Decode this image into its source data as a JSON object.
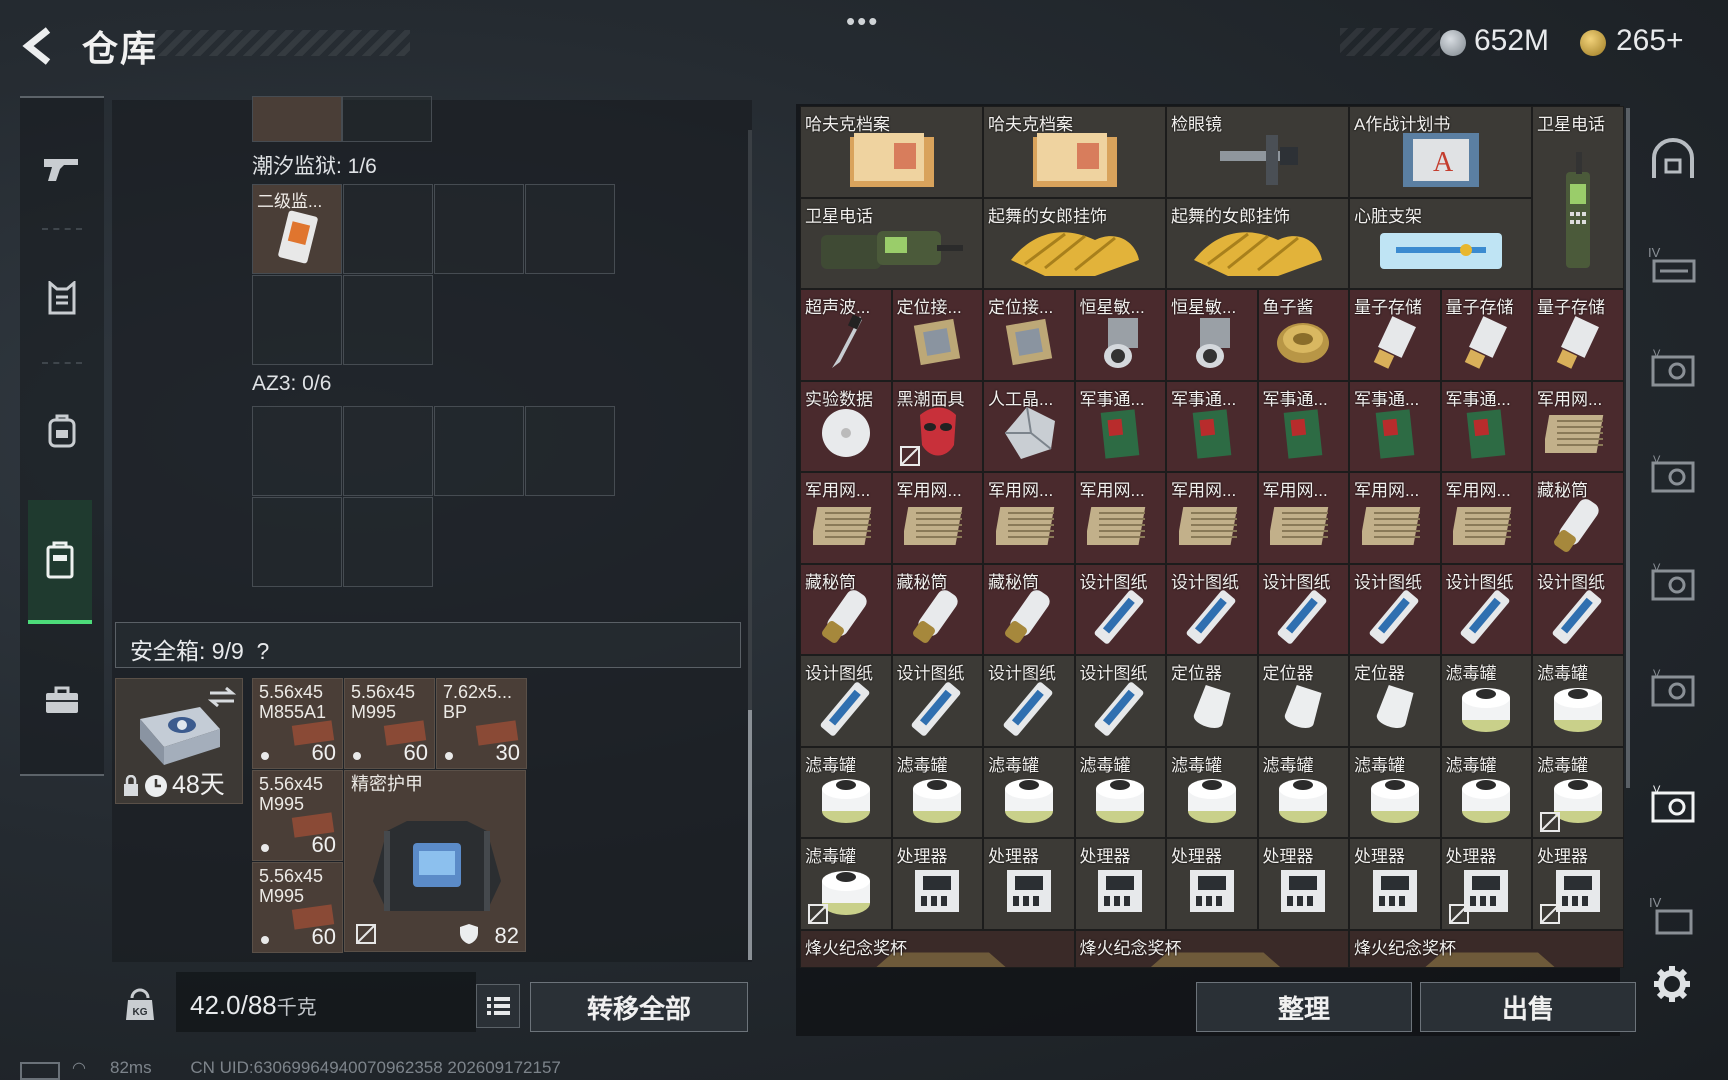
{
  "header": {
    "title": "仓库",
    "currency1": "652M",
    "currency2": "265+"
  },
  "left_tabs": [
    "gun-icon",
    "armor-icon",
    "backpack-icon",
    "locker-icon",
    "case-icon"
  ],
  "middle": {
    "section1": "潮汐监狱: 1/6",
    "section1_item": "二级监...",
    "section2": "AZ3: 0/6",
    "safe_box": "安全箱: 9/9",
    "safe_help": "?",
    "case_time": "48天",
    "slots": [
      {
        "name": "5.56x45\nM855A1",
        "count": "60"
      },
      {
        "name": "5.56x45\nM995",
        "count": "60"
      },
      {
        "name": "7.62x5...\nBP",
        "count": "30"
      },
      {
        "name": "5.56x45\nM995",
        "count": "60"
      },
      {
        "name": "5.56x45\nM995",
        "count": "60"
      }
    ],
    "armor": {
      "name": "精密护甲",
      "durability": "82"
    },
    "weight_value": "42.0/88",
    "weight_unit": "千克",
    "transfer_all": "转移全部"
  },
  "stash_items": [
    {
      "name": "哈夫克档案",
      "span": 2,
      "bg": "#3c3a36",
      "icon": "folder"
    },
    {
      "name": "哈夫克档案",
      "span": 2,
      "bg": "#3c3a36",
      "icon": "folder"
    },
    {
      "name": "检眼镜",
      "span": 2,
      "bg": "#3c3a36",
      "icon": "scope"
    },
    {
      "name": "A作战计划书",
      "span": 2,
      "bg": "#3c3a36",
      "icon": "plan"
    },
    {
      "name": "卫星电话",
      "span": 1,
      "tall": true,
      "bg": "#3c3a36",
      "icon": "phone"
    },
    {
      "name": "卫星电话",
      "span": 2,
      "bg": "#3c3a36",
      "icon": "phone2"
    },
    {
      "name": "起舞的女郎挂饰",
      "span": 2,
      "bg": "#3c3a36",
      "icon": "gold"
    },
    {
      "name": "起舞的女郎挂饰",
      "span": 2,
      "bg": "#3c3a36",
      "icon": "gold"
    },
    {
      "name": "心脏支架",
      "span": 2,
      "bg": "#3c3a36",
      "icon": "stent"
    },
    {
      "name": "超声波...",
      "bg": "#4a2a2d",
      "icon": "pen"
    },
    {
      "name": "定位接...",
      "bg": "#4a2a2d",
      "icon": "chip"
    },
    {
      "name": "定位接...",
      "bg": "#4a2a2d",
      "icon": "chip"
    },
    {
      "name": "恒星敏...",
      "bg": "#4a2a2d",
      "icon": "lens"
    },
    {
      "name": "恒星敏...",
      "bg": "#4a2a2d",
      "icon": "lens"
    },
    {
      "name": "鱼子酱",
      "bg": "#4a2a2d",
      "icon": "caviar"
    },
    {
      "name": "量子存储",
      "bg": "#4a2a2d",
      "icon": "usb"
    },
    {
      "name": "量子存储",
      "bg": "#4a2a2d",
      "icon": "usb"
    },
    {
      "name": "量子存储",
      "bg": "#4a2a2d",
      "icon": "usb"
    },
    {
      "name": "实验数据",
      "bg": "#4a2a2d",
      "icon": "disc"
    },
    {
      "name": "黑潮面具",
      "bg": "#4a2a2d",
      "icon": "mask",
      "nolock": true
    },
    {
      "name": "人工晶...",
      "bg": "#4a2a2d",
      "icon": "crystal"
    },
    {
      "name": "军事通...",
      "bg": "#4a2a2d",
      "icon": "book"
    },
    {
      "name": "军事通...",
      "bg": "#4a2a2d",
      "icon": "book"
    },
    {
      "name": "军事通...",
      "bg": "#4a2a2d",
      "icon": "book"
    },
    {
      "name": "军事通...",
      "bg": "#4a2a2d",
      "icon": "book"
    },
    {
      "name": "军事通...",
      "bg": "#4a2a2d",
      "icon": "book"
    },
    {
      "name": "军用网...",
      "bg": "#4a2a2d",
      "icon": "net"
    },
    {
      "name": "军用网...",
      "bg": "#4a2a2d",
      "icon": "net"
    },
    {
      "name": "军用网...",
      "bg": "#4a2a2d",
      "icon": "net"
    },
    {
      "name": "军用网...",
      "bg": "#4a2a2d",
      "icon": "net"
    },
    {
      "name": "军用网...",
      "bg": "#4a2a2d",
      "icon": "net"
    },
    {
      "name": "军用网...",
      "bg": "#4a2a2d",
      "icon": "net"
    },
    {
      "name": "军用网...",
      "bg": "#4a2a2d",
      "icon": "net"
    },
    {
      "name": "军用网...",
      "bg": "#4a2a2d",
      "icon": "net"
    },
    {
      "name": "军用网...",
      "bg": "#4a2a2d",
      "icon": "net"
    },
    {
      "name": "藏秘筒",
      "bg": "#4a2a2d",
      "icon": "tube"
    },
    {
      "name": "藏秘筒",
      "bg": "#4a2a2d",
      "icon": "tube"
    },
    {
      "name": "藏秘筒",
      "bg": "#4a2a2d",
      "icon": "tube"
    },
    {
      "name": "藏秘筒",
      "bg": "#4a2a2d",
      "icon": "tube"
    },
    {
      "name": "设计图纸",
      "bg": "#4a2a2d",
      "icon": "tubeblue"
    },
    {
      "name": "设计图纸",
      "bg": "#4a2a2d",
      "icon": "tubeblue"
    },
    {
      "name": "设计图纸",
      "bg": "#4a2a2d",
      "icon": "tubeblue"
    },
    {
      "name": "设计图纸",
      "bg": "#4a2a2d",
      "icon": "tubeblue"
    },
    {
      "name": "设计图纸",
      "bg": "#4a2a2d",
      "icon": "tubeblue"
    },
    {
      "name": "设计图纸",
      "bg": "#4a2a2d",
      "icon": "tubeblue"
    },
    {
      "name": "设计图纸",
      "bg": "#3c3a36",
      "icon": "tubeblue"
    },
    {
      "name": "设计图纸",
      "bg": "#3c3a36",
      "icon": "tubeblue"
    },
    {
      "name": "设计图纸",
      "bg": "#3c3a36",
      "icon": "tubeblue"
    },
    {
      "name": "设计图纸",
      "bg": "#3c3a36",
      "icon": "tubeblue"
    },
    {
      "name": "定位器",
      "bg": "#3c3a36",
      "icon": "locator"
    },
    {
      "name": "定位器",
      "bg": "#3c3a36",
      "icon": "locator"
    },
    {
      "name": "定位器",
      "bg": "#3c3a36",
      "icon": "locator"
    },
    {
      "name": "滤毒罐",
      "bg": "#3c3a36",
      "icon": "filter"
    },
    {
      "name": "滤毒罐",
      "bg": "#3c3a36",
      "icon": "filter"
    },
    {
      "name": "滤毒罐",
      "bg": "#3c3a36",
      "icon": "filter"
    },
    {
      "name": "滤毒罐",
      "bg": "#3c3a36",
      "icon": "filter"
    },
    {
      "name": "滤毒罐",
      "bg": "#3c3a36",
      "icon": "filter"
    },
    {
      "name": "滤毒罐",
      "bg": "#3c3a36",
      "icon": "filter"
    },
    {
      "name": "滤毒罐",
      "bg": "#3c3a36",
      "icon": "filter"
    },
    {
      "name": "滤毒罐",
      "bg": "#3c3a36",
      "icon": "filter"
    },
    {
      "name": "滤毒罐",
      "bg": "#3c3a36",
      "icon": "filter"
    },
    {
      "name": "滤毒罐",
      "bg": "#3c3a36",
      "icon": "filter"
    },
    {
      "name": "滤毒罐",
      "bg": "#3c3a36",
      "icon": "filter",
      "nolock": true
    },
    {
      "name": "滤毒罐",
      "bg": "#3c3a36",
      "icon": "filter",
      "nolock": true
    },
    {
      "name": "处理器",
      "bg": "#3c3a36",
      "icon": "cpu"
    },
    {
      "name": "处理器",
      "bg": "#3c3a36",
      "icon": "cpu"
    },
    {
      "name": "处理器",
      "bg": "#3c3a36",
      "icon": "cpu"
    },
    {
      "name": "处理器",
      "bg": "#3c3a36",
      "icon": "cpu"
    },
    {
      "name": "处理器",
      "bg": "#3c3a36",
      "icon": "cpu"
    },
    {
      "name": "处理器",
      "bg": "#3c3a36",
      "icon": "cpu"
    },
    {
      "name": "处理器",
      "bg": "#3c3a36",
      "icon": "cpu",
      "nolock": true
    },
    {
      "name": "处理器",
      "bg": "#3c3a36",
      "icon": "cpu",
      "nolock": true
    }
  ],
  "trophies": [
    "烽火纪念奖杯",
    "烽火纪念奖杯",
    "烽火纪念奖杯"
  ],
  "buttons": {
    "sort": "整理",
    "sell": "出售"
  },
  "right_tabs": [
    "vault-icon",
    "tier4-crate-icon",
    "crate-icon",
    "crate-icon",
    "crate-icon",
    "crate-icon",
    "crate-active-icon",
    "tier4-box-icon",
    "settings-icon"
  ],
  "status": {
    "ping": "82ms",
    "uid": "CN UID:6306996494007096235​8 202609172157"
  },
  "colors": {
    "active_green": "#4ddc7a",
    "red_cell": "#4a2a2d",
    "neutral_cell": "#3c3a36"
  }
}
